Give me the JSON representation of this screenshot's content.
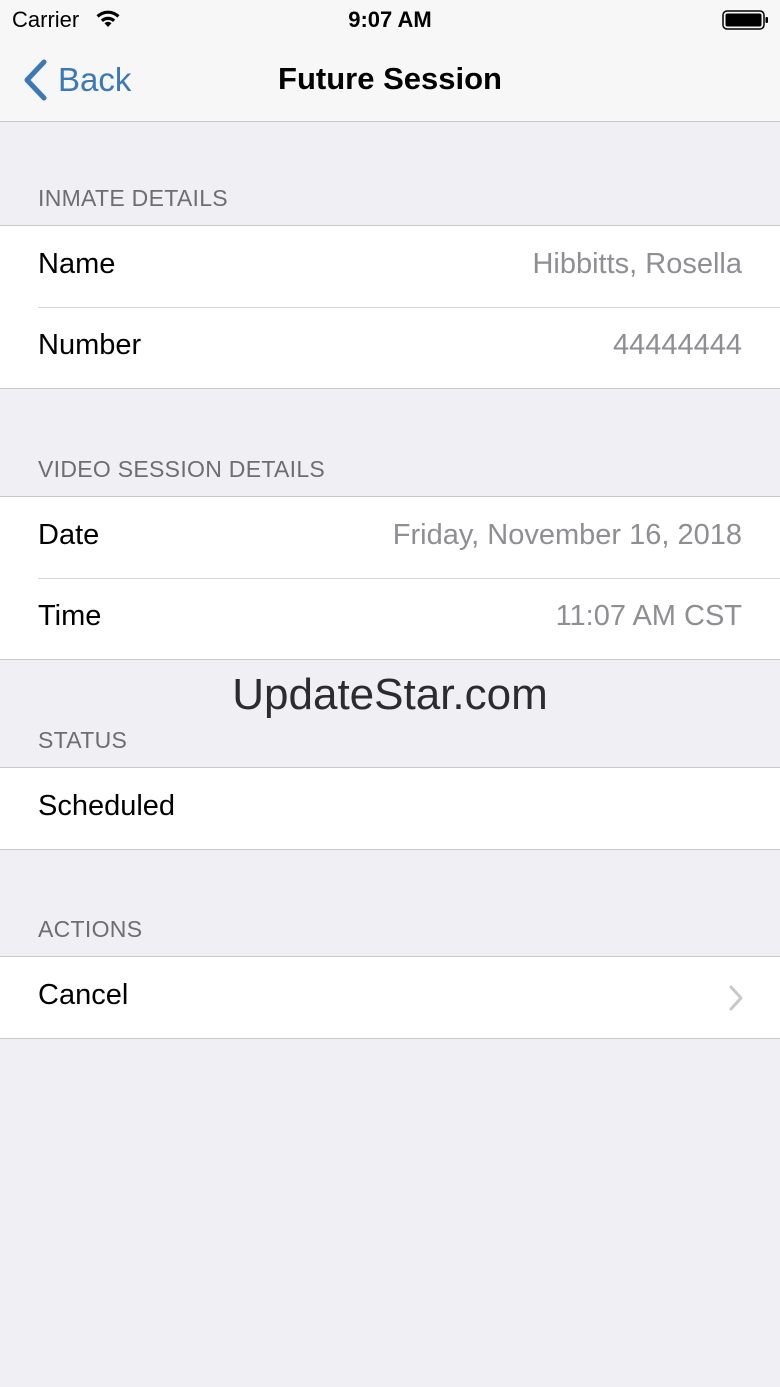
{
  "status_bar": {
    "carrier": "Carrier",
    "time": "9:07 AM",
    "wifi_icon": "wifi-icon",
    "battery_icon": "battery-full-icon"
  },
  "nav_bar": {
    "back_label": "Back",
    "title": "Future Session",
    "accent_color": "#3a78b8"
  },
  "sections": {
    "inmate_details": {
      "header": "INMATE DETAILS",
      "rows": [
        {
          "label": "Name",
          "value": "Hibbitts, Rosella"
        },
        {
          "label": "Number",
          "value": "44444444"
        }
      ]
    },
    "video_session_details": {
      "header": "VIDEO SESSION DETAILS",
      "rows": [
        {
          "label": "Date",
          "value": "Friday, November 16, 2018"
        },
        {
          "label": "Time",
          "value": "11:07 AM CST"
        }
      ]
    },
    "status": {
      "header": "STATUS",
      "rows": [
        {
          "label": "Scheduled"
        }
      ]
    },
    "actions": {
      "header": "ACTIONS",
      "rows": [
        {
          "label": "Cancel",
          "icon": "chevron-right-icon"
        }
      ]
    }
  },
  "watermark": "UpdateStar.com"
}
